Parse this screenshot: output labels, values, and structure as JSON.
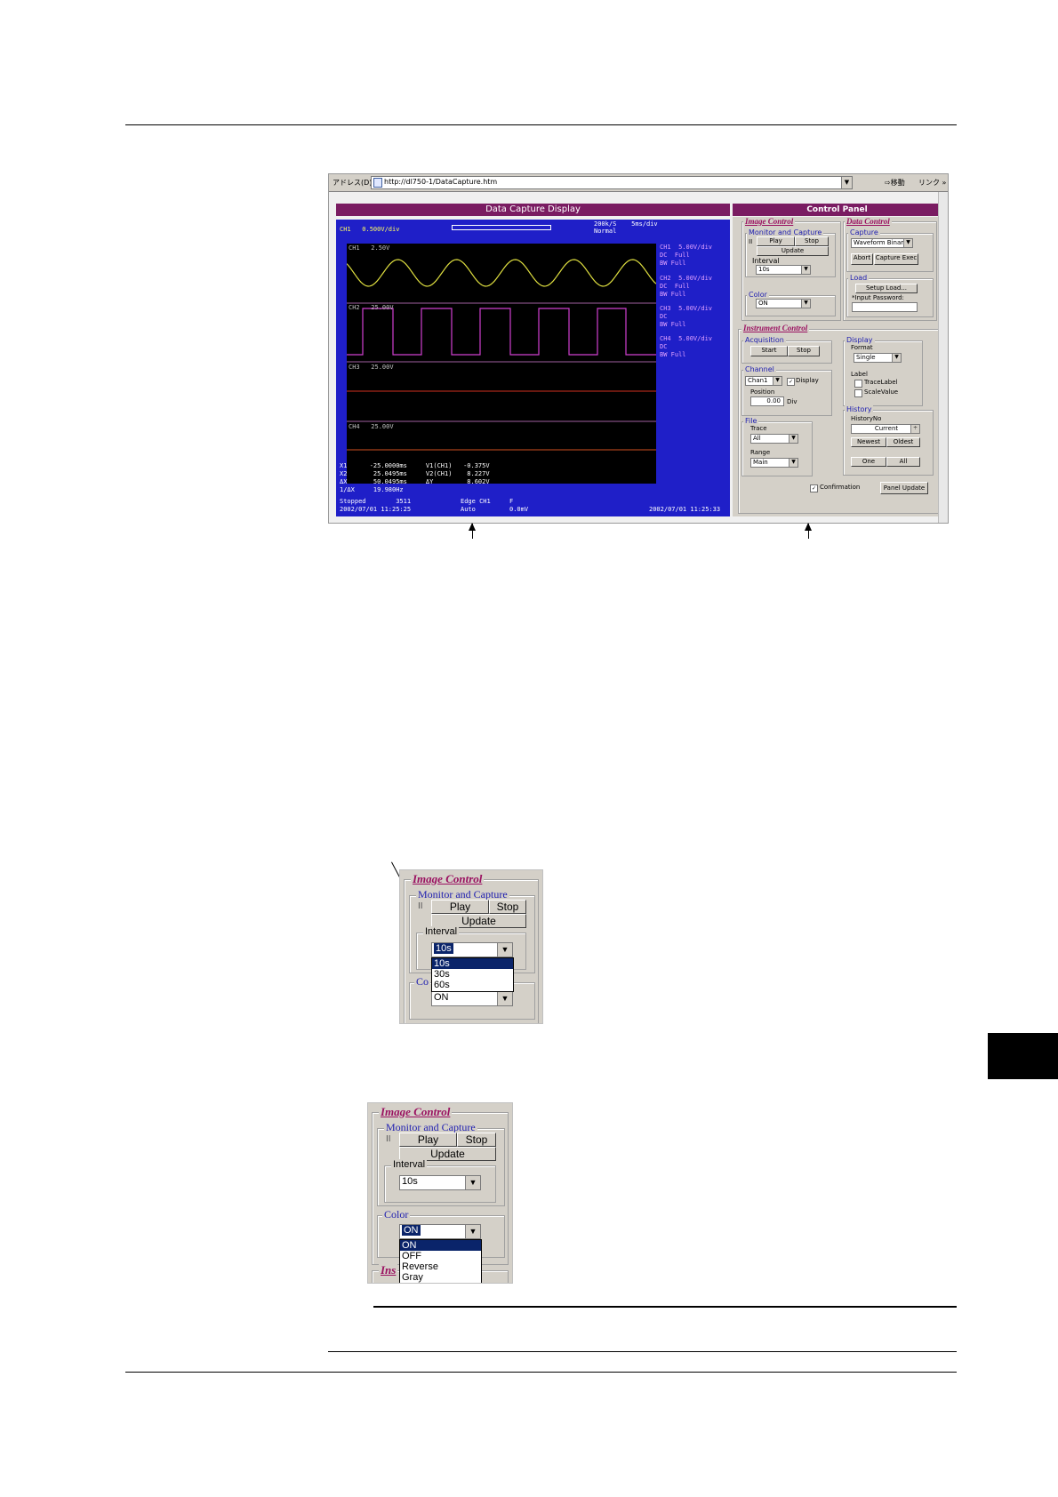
{
  "browser": {
    "address_label": "アドレス(D)",
    "url": "http://dl750-1/DataCapture.htm",
    "go_label": "移動",
    "links_label": "リンク »"
  },
  "display": {
    "title": "Data Capture Display",
    "header_left": "CH1   0.500V/div",
    "header_rate": "200k/S    5ms/div",
    "header_mode": "Normal",
    "ch_labels": [
      "CH1  5.00V/div\nDC  Full\nBW Full",
      "CH2  5.00V/div\nDC  Full\nBW Full",
      "CH3  5.00V/div\nDC\nBW Full",
      "CH4  5.00V/div\nDC\nBW Full"
    ],
    "cursor_rows": [
      "X1      -25.0000ms     V1(CH1)   -0.375V",
      "X2       25.0495ms     V2(CH1)    8.227V",
      "ΔX       50.0495ms     ΔY         8.602V",
      "1/ΔX     19.980Hz"
    ],
    "status_left": "Stopped        3511",
    "status_date_left": "2002/07/01 11:25:25",
    "trigger": "Edge CH1",
    "trigger_mode": "Auto",
    "trigger_f": "F",
    "trigger_value": "0.0mV",
    "status_date_right": "2002/07/01 11:25:33"
  },
  "control_panel": {
    "title": "Control Panel",
    "image_control": {
      "heading": "Image Control",
      "monitor_capture": "Monitor and Capture",
      "pause_icon": "II",
      "play": "Play",
      "stop": "Stop",
      "update": "Update",
      "interval_label": "Interval",
      "interval_value": "10s",
      "color_label": "Color",
      "color_value": "ON"
    },
    "data_control": {
      "heading": "Data Control",
      "capture_label": "Capture",
      "capture_value": "Waveform Binary",
      "abort": "Abort",
      "capture_exec": "Capture Exec",
      "load_label": "Load",
      "setup_load": "Setup Load...",
      "password_label": "*Input Password:"
    },
    "instrument_control": {
      "heading": "Instrument Control",
      "acquisition_label": "Acquisition",
      "start": "Start",
      "stop": "Stop",
      "channel_label": "Channel",
      "channel_value": "Chan1",
      "display_check": "Display",
      "position_label": "Position",
      "position_value": "0.00",
      "div": "Div",
      "file_label": "File",
      "trace_label": "Trace",
      "trace_value": "All",
      "range_label": "Range",
      "range_value": "Main",
      "display_label": "Display",
      "format_label": "Format",
      "format_value": "Single",
      "label_label": "Label",
      "trace_label_check": "TraceLabel",
      "scale_value_check": "ScaleValue",
      "history_label": "History",
      "history_no": "HistoryNo",
      "history_value": "Current",
      "newest": "Newest",
      "oldest": "Oldest",
      "one": "One",
      "all": "All",
      "confirmation": "Confirmation",
      "panel_update": "Panel Update"
    }
  },
  "zoom_interval": {
    "heading": "Image Control",
    "monitor_capture": "Monitor and Capture",
    "pause_icon": "II",
    "play": "Play",
    "stop": "Stop",
    "update": "Update",
    "interval_label": "Interval",
    "selected": "10s",
    "options": [
      "10s",
      "30s",
      "60s"
    ],
    "color_partial": "Co",
    "color_value": "ON"
  },
  "zoom_color": {
    "heading": "Image Control",
    "monitor_capture": "Monitor and Capture",
    "pause_icon": "II",
    "play": "Play",
    "stop": "Stop",
    "update": "Update",
    "interval_label": "Interval",
    "interval_value": "10s",
    "color_label": "Color",
    "selected": "ON",
    "options": [
      "ON",
      "OFF",
      "Reverse",
      "Gray"
    ],
    "next_heading_partial": "Ins"
  }
}
